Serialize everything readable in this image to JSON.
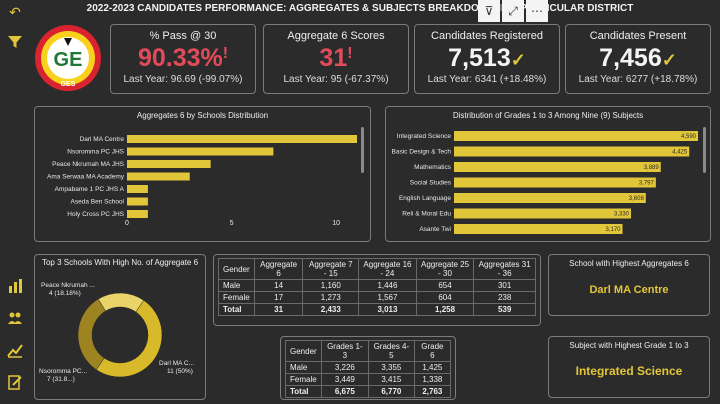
{
  "title": "2022-2023 CANDIDATES PERFORMANCE: AGGREGATES & SUBJECTS BREAKDOWN IN A PARTICULAR DISTRICT",
  "logo": {
    "top_text": "GHANA EDUCATION SERVICE",
    "initials": "GES",
    "center": "GE"
  },
  "kpis": [
    {
      "label": "% Pass @ 30",
      "value": "90.33%",
      "mark": "!",
      "sub": "Last Year: 96.69 (-99.07%)"
    },
    {
      "label": "Aggregate 6 Scores",
      "value": "31",
      "mark": "!",
      "sub": "Last Year: 95 (-67.37%)"
    },
    {
      "label": "Candidates Registered",
      "value": "7,513",
      "mark": "✓",
      "sub": "Last Year: 6341 (+18.48%)"
    },
    {
      "label": "Candidates Present",
      "value": "7,456",
      "mark": "✓",
      "sub": "Last Year: 6277 (+18.78%)"
    }
  ],
  "chart_data": [
    {
      "type": "bar",
      "title": "Aggregates 6 by Schools Distribution",
      "categories": [
        "Darl MA Centre",
        "Nsoromma PC JHS",
        "Peace Nkrumah MA JHS",
        "Ama Serwaa MA Academy",
        "Ampabame 1 PC JHS A",
        "Aseda Ben School",
        "Holy Cross PC JHS"
      ],
      "values": [
        11,
        7,
        4,
        3,
        1,
        1,
        1
      ],
      "xlim": [
        0,
        11
      ],
      "xticks": [
        "0",
        "5",
        "10"
      ]
    },
    {
      "type": "bar",
      "title": "Distribution of Grades  1 to 3 Among Nine (9) Subjects",
      "categories": [
        "Integrated Science",
        "Basic Design & Tech",
        "Mathematics",
        "Social Studies",
        "English Language",
        "Reli & Moral Edu",
        "Asante Twi"
      ],
      "values": [
        4590,
        4425,
        3889,
        3797,
        3608,
        3330,
        3170
      ],
      "labels": [
        "4,590",
        "4,425",
        "3,889",
        "3,797",
        "3,608",
        "3,330",
        "3,170"
      ]
    },
    {
      "type": "pie",
      "title": "Top 3 Schools With High No. of Aggregate 6",
      "slices": [
        {
          "label": "Darl MA C...",
          "detail": "11 (50%)",
          "value": 11
        },
        {
          "label": "Nsoromma PC...",
          "detail": "7 (31.8...)",
          "value": 7
        },
        {
          "label": "Peace Nkrumah ...",
          "detail": "4 (18.18%)",
          "value": 4
        }
      ]
    }
  ],
  "agg_table": {
    "headers": [
      "Gender",
      "Aggregate 6",
      "Aggregate 7 - 15",
      "Aggregate 16 - 24",
      "Aggregate 25 - 30",
      "Aggregates 31 - 36"
    ],
    "rows": [
      [
        "Male",
        "14",
        "1,160",
        "1,446",
        "654",
        "301"
      ],
      [
        "Female",
        "17",
        "1,273",
        "1,567",
        "604",
        "238"
      ],
      [
        "Total",
        "31",
        "2,433",
        "3,013",
        "1,258",
        "539"
      ]
    ]
  },
  "grade_table": {
    "headers": [
      "Gender",
      "Grades 1- 3",
      "Grades 4-5",
      "Grade 6"
    ],
    "rows": [
      [
        "Male",
        "3,226",
        "3,355",
        "1,425"
      ],
      [
        "Female",
        "3,449",
        "3,415",
        "1,338"
      ],
      [
        "Total",
        "6,675",
        "6,770",
        "2,763"
      ]
    ]
  },
  "highest_school": {
    "label": "School with Highest Aggregates 6",
    "value": "Darl MA Centre"
  },
  "highest_subject": {
    "label": "Subject with Highest Grade 1 to 3",
    "value": "Integrated Science"
  },
  "colors": {
    "bar": "#e2c63a",
    "bg": "#2b2b2b",
    "red": "#e24b5a"
  }
}
